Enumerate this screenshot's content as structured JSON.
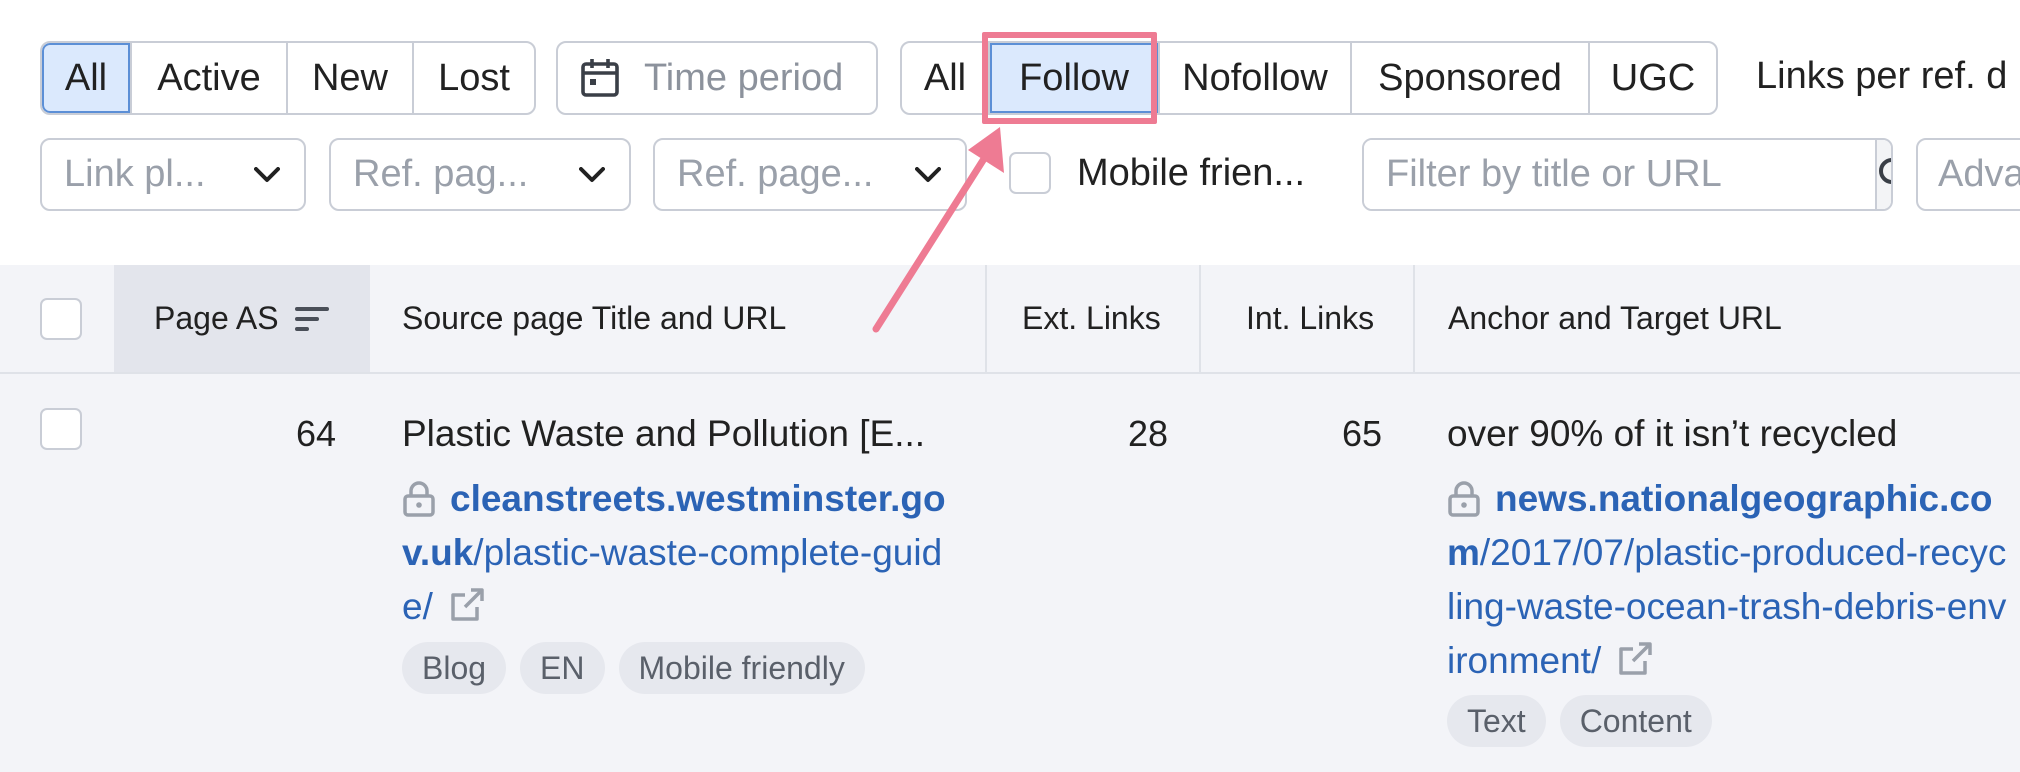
{
  "toolbar": {
    "status_filter": [
      "All",
      "Active",
      "New",
      "Lost"
    ],
    "status_selected": "All",
    "time_period_label": "Time period",
    "link_type_filter": [
      "All",
      "Follow",
      "Nofollow",
      "Sponsored",
      "UGC"
    ],
    "link_type_selected": "Follow",
    "links_per_ref_label": "Links per ref. d",
    "dropdowns": {
      "link_placement": "Link pl...",
      "ref_page_1": "Ref. pag...",
      "ref_page_2": "Ref. page..."
    },
    "mobile_friendly_label": "Mobile frien...",
    "filter_placeholder": "Filter by title or URL",
    "advanced_label": "Adva"
  },
  "table": {
    "headers": {
      "page_as": "Page AS",
      "source": "Source page Title and URL",
      "ext_links": "Ext. Links",
      "int_links": "Int. Links",
      "anchor": "Anchor and Target URL"
    },
    "rows": [
      {
        "page_as": "64",
        "source_title": "Plastic Waste and Pollution [E...",
        "source_url_domain": "cleanstreets.westminster.gov.uk",
        "source_url_path": "/plastic-waste-complete-guide/",
        "source_tags": [
          "Blog",
          "EN",
          "Mobile friendly"
        ],
        "ext_links": "28",
        "int_links": "65",
        "anchor_text": "over 90% of it isn’t recycled",
        "target_url_domain": "news.nationalgeographic.com",
        "target_url_path": "/2017/07/plastic-produced-recycling-waste-ocean-trash-debris-environment/",
        "target_tags": [
          "Text",
          "Content"
        ]
      }
    ]
  },
  "colors": {
    "highlight": "#ee7b93",
    "link": "#2b63b5",
    "selected_bg": "#dbe9fd"
  },
  "icons": [
    "calendar-icon",
    "chevron-down-icon",
    "search-icon",
    "sort-icon",
    "lock-icon",
    "external-link-icon",
    "annotation-arrow"
  ]
}
